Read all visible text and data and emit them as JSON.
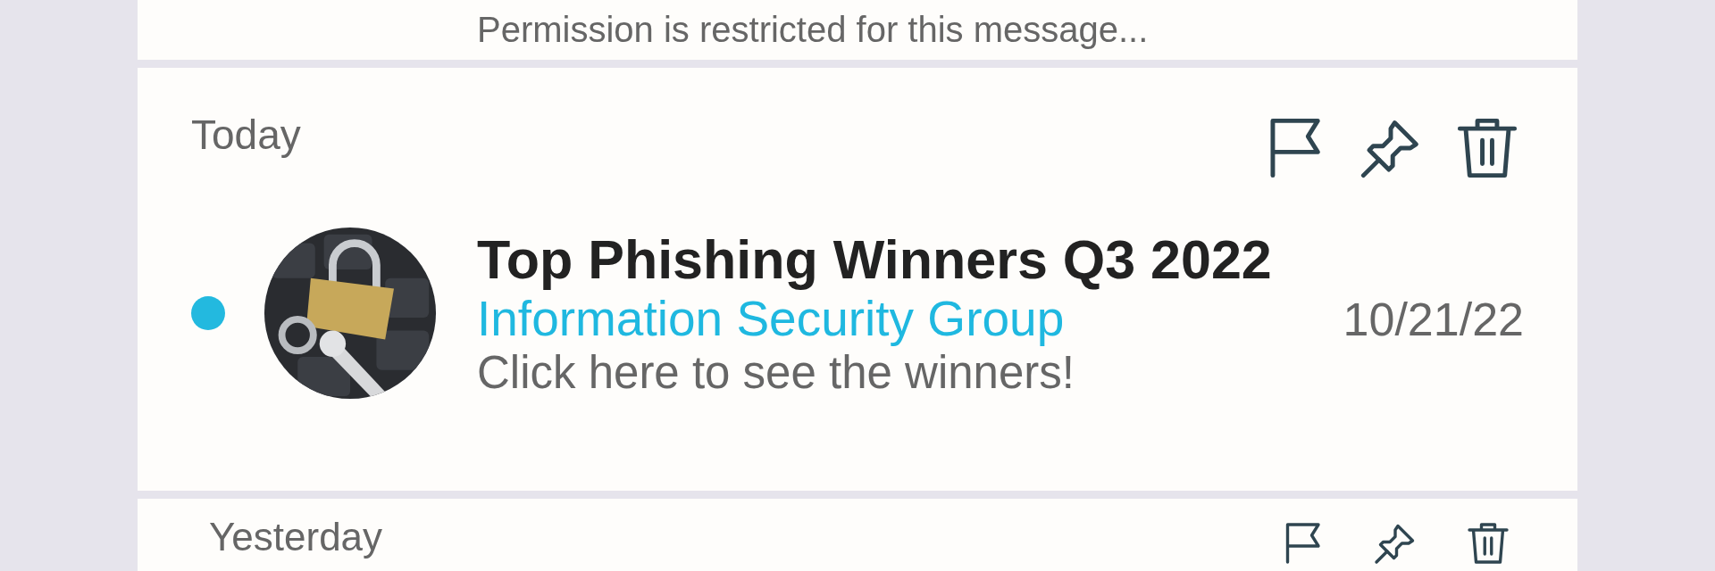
{
  "sections": [
    {
      "kind": "preview",
      "snippet": "Permission is restricted for this message..."
    },
    {
      "kind": "message",
      "heading": "Today",
      "unread": true,
      "title": "Top Phishing Winners Q3 2022",
      "sender": "Information Security Group",
      "date": "10/21/22",
      "snippet": "Click here to see the winners!"
    },
    {
      "kind": "header",
      "heading": "Yesterday"
    }
  ]
}
